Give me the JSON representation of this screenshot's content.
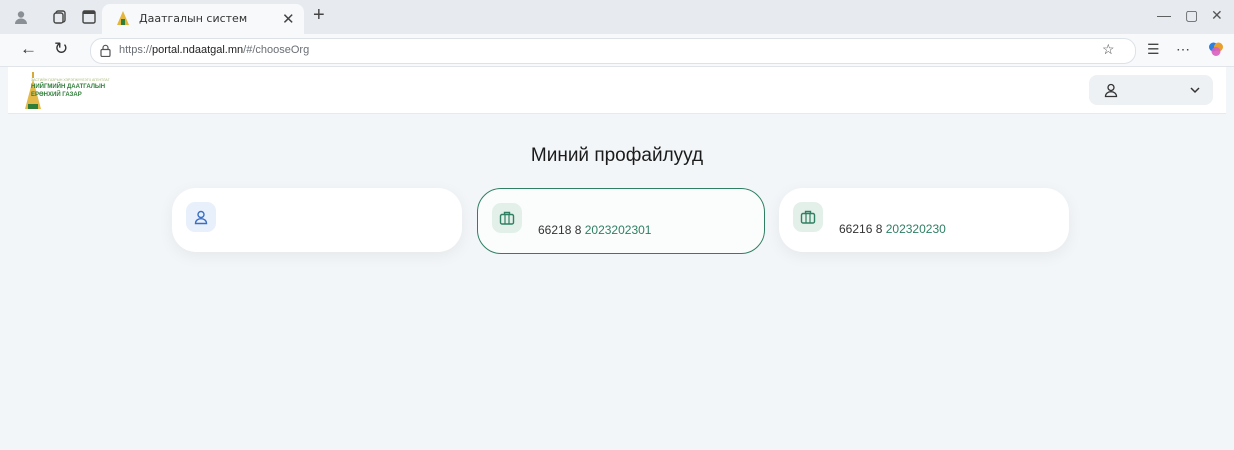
{
  "browser": {
    "tab_title": "Даатгалын систем",
    "url_prefix": "https://",
    "url_host": "portal.ndaatgal.mn",
    "url_path": "/#/chooseOrg"
  },
  "header": {
    "logo_line1": "ЗАСГИЙН ГАЗРЫН ХЭРЭГЖҮҮЛЭГЧ АГЕНТЛАГ",
    "logo_line2": "НИЙГМИЙН ДААТГАЛЫН",
    "logo_line3": "ЕРӨНХИЙ ГАЗАР"
  },
  "main": {
    "title": "Миний профайлууд",
    "profiles": [
      {
        "icon": "user-icon",
        "text": "",
        "code": ""
      },
      {
        "icon": "briefcase-icon",
        "text": "66218 8",
        "code": "2023202301"
      },
      {
        "icon": "briefcase-icon",
        "text": "66216 8",
        "code": "202320230"
      }
    ]
  },
  "colors": {
    "accent": "#2f7f62",
    "background": "#f3f6f9",
    "logo_green": "#2f7d39"
  }
}
